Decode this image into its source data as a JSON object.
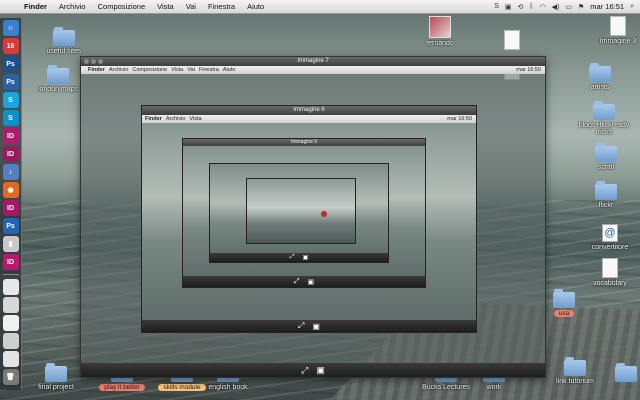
{
  "menubar": {
    "app": "Finder",
    "items": [
      "Archivio",
      "Composizione",
      "Vista",
      "Vai",
      "Finestra",
      "Aiuto"
    ],
    "clock": "mar 16:51"
  },
  "dock": {
    "items": [
      {
        "name": "finder",
        "glyph": "☺",
        "color": "#3b7fd1"
      },
      {
        "name": "calendar",
        "glyph": "16",
        "color": "#d93b3b"
      },
      {
        "name": "photoshop",
        "glyph": "Ps",
        "color": "#1d4f8a"
      },
      {
        "name": "photoshop-2",
        "glyph": "Ps",
        "color": "#2a61a3"
      },
      {
        "name": "skype",
        "glyph": "S",
        "color": "#18a6e0"
      },
      {
        "name": "skype-2",
        "glyph": "S",
        "color": "#1090c8"
      },
      {
        "name": "indesign",
        "glyph": "ID",
        "color": "#b21a6b"
      },
      {
        "name": "indesign-2",
        "glyph": "ID",
        "color": "#9a1a5d"
      },
      {
        "name": "itunes",
        "glyph": "♪",
        "color": "#5480c0"
      },
      {
        "name": "firefox",
        "glyph": "◉",
        "color": "#e06a1f"
      },
      {
        "name": "indesign-3",
        "glyph": "ID",
        "color": "#a8166a"
      },
      {
        "name": "photoshop-3",
        "glyph": "Ps",
        "color": "#2266b0"
      },
      {
        "name": "ipod",
        "glyph": "▮",
        "color": "#c8c8c8"
      },
      {
        "name": "indesign-4",
        "glyph": "ID",
        "color": "#b8196e"
      }
    ],
    "lower": [
      {
        "name": "doc-thumb-1",
        "glyph": "",
        "color": "#e8e8e8"
      },
      {
        "name": "doc-thumb-2",
        "glyph": "",
        "color": "#d8d8d8"
      },
      {
        "name": "doc-thumb-3",
        "glyph": "",
        "color": "#f0f0f0"
      },
      {
        "name": "doc-thumb-4",
        "glyph": "",
        "color": "#cfcfcf"
      },
      {
        "name": "doc-thumb-5",
        "glyph": "",
        "color": "#e4e4e4"
      },
      {
        "name": "trash",
        "glyph": "🗑",
        "color": "#7a7a7a"
      }
    ]
  },
  "desktop": {
    "useful_sites": "useful sites",
    "london_maps": "london maps",
    "fernando": "fernando",
    "immagine3": "Immagine 3",
    "artists": "artists",
    "blogs": "blogs+flickr+adv",
    "blogs_line2": "tricks",
    "scritti": "scritti",
    "flickr": "flickr",
    "convertitore": "convertitore",
    "vocabulary": "vocabulary",
    "final_project": "final project",
    "play_it_better": "play it better",
    "skills_module": "skills module",
    "english_book": "english book",
    "bucks_lectures": "Bucks Lectures",
    "work": "work",
    "link_tutorium": "link tutorium",
    "usa": "usa"
  },
  "window": {
    "title": "Immagine 7",
    "nested_title_2": "Immagine 6",
    "nested_title_3": "Immagine 5",
    "finder": "Finder",
    "menu": [
      "Archivio",
      "Composizione",
      "Vista",
      "Vai",
      "Finestra",
      "Aiuto"
    ],
    "clock": "mar 16:50"
  }
}
